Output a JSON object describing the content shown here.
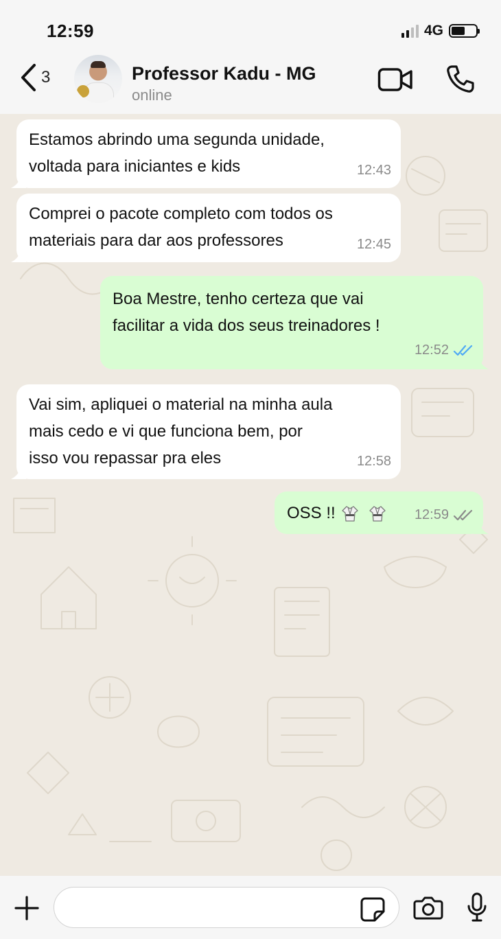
{
  "status_bar": {
    "time": "12:59",
    "network": "4G",
    "battery_level": 0.55
  },
  "header": {
    "back_count": "3",
    "contact_name": "Professor Kadu - MG",
    "contact_status": "online"
  },
  "messages": [
    {
      "direction": "incoming",
      "text": "Estamos abrindo uma segunda unidade,\nvoltada para iniciantes e kids",
      "time": "12:43"
    },
    {
      "direction": "incoming",
      "text": "Comprei o pacote completo com todos os\nmateriais para dar aos professores",
      "time": "12:45"
    },
    {
      "direction": "outgoing",
      "text": "Boa Mestre, tenho certeza que vai\nfacilitar a vida dos seus treinadores !",
      "time": "12:52",
      "read": true
    },
    {
      "direction": "incoming",
      "text": "Vai sim, apliquei o material na minha aula\nmais cedo e vi que funciona bem, por\nisso vou repassar pra eles",
      "time": "12:58"
    },
    {
      "direction": "outgoing",
      "text": "OSS !!",
      "emoji": [
        "martial-arts-uniform-icon",
        "martial-arts-uniform-icon"
      ],
      "time": "12:59",
      "read": false
    }
  ],
  "input": {
    "placeholder": ""
  },
  "colors": {
    "incoming_bubble": "#ffffff",
    "outgoing_bubble": "#d9fdd3",
    "read_ticks": "#4fa9f5",
    "delivered_ticks": "#8a8a8a",
    "chat_background": "#efeae2"
  }
}
